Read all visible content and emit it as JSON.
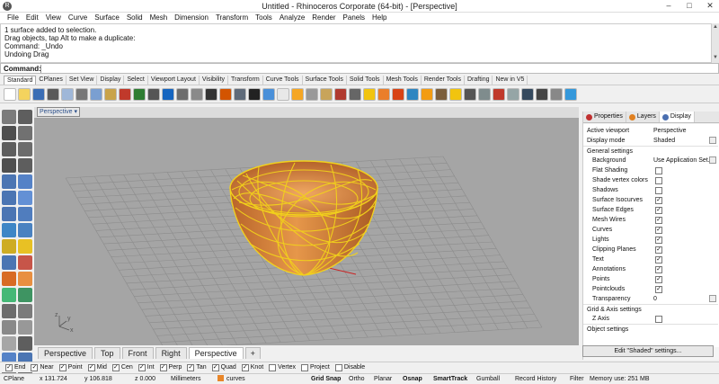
{
  "window": {
    "title": "Untitled - Rhinoceros Corporate (64-bit) - [Perspective]",
    "app_icon": "rhino-app-icon",
    "controls": {
      "minimize": "–",
      "maximize": "□",
      "close": "✕"
    }
  },
  "menu": [
    "File",
    "Edit",
    "View",
    "Curve",
    "Surface",
    "Solid",
    "Mesh",
    "Dimension",
    "Transform",
    "Tools",
    "Analyze",
    "Render",
    "Panels",
    "Help"
  ],
  "command_history": [
    "1 surface added to selection.",
    "Drag objects, tap Alt to make a duplicate:",
    "Command: _Undo",
    "Undoing Drag"
  ],
  "command_line": {
    "label": "Command:",
    "value": ""
  },
  "toolbar_tabs": [
    "Standard",
    "CPlanes",
    "Set View",
    "Display",
    "Select",
    "Viewport Layout",
    "Visibility",
    "Transform",
    "Curve Tools",
    "Surface Tools",
    "Solid Tools",
    "Mesh Tools",
    "Render Tools",
    "Drafting",
    "New in V5"
  ],
  "toolbar_active_tab": "Standard",
  "viewport": {
    "name": "Perspective",
    "background": "#a5a5a5",
    "object_color": "#d9823a",
    "wire_color": "#f2d21b",
    "axis_labels": {
      "z": "z",
      "y": "y",
      "x": "x"
    }
  },
  "viewport_tabs": [
    "Perspective",
    "Top",
    "Front",
    "Right",
    "Perspective",
    "+"
  ],
  "panel_tabs": [
    {
      "label": "Properties",
      "icon": "properties-icon",
      "color": "#c03030"
    },
    {
      "label": "Layers",
      "icon": "layers-icon",
      "color": "#e08020"
    },
    {
      "label": "Display",
      "icon": "display-icon",
      "color": "#4a6fb0"
    }
  ],
  "display_panel": {
    "active_viewport_label": "Active viewport",
    "active_viewport": "Perspective",
    "display_mode_label": "Display mode",
    "display_mode": "Shaded",
    "general_settings": "General settings",
    "background_label": "Background",
    "background_value": "Use Application Set...",
    "settings": [
      {
        "label": "Flat Shading",
        "checked": false
      },
      {
        "label": "Shade vertex colors",
        "checked": false
      },
      {
        "label": "Shadows",
        "checked": false
      },
      {
        "label": "Surface Isocurves",
        "checked": true
      },
      {
        "label": "Surface Edges",
        "checked": true
      },
      {
        "label": "Mesh Wires",
        "checked": true
      },
      {
        "label": "Curves",
        "checked": true
      },
      {
        "label": "Lights",
        "checked": true
      },
      {
        "label": "Clipping Planes",
        "checked": true
      },
      {
        "label": "Text",
        "checked": true
      },
      {
        "label": "Annotations",
        "checked": true
      },
      {
        "label": "Points",
        "checked": true
      },
      {
        "label": "Pointclouds",
        "checked": true
      }
    ],
    "transparency_label": "Transparency",
    "transparency_value": "0",
    "grid_axis": "Grid & Axis settings",
    "z_axis_label": "Z Axis",
    "object_settings": "Object settings",
    "edit_button": "Edit \"Shaded\" settings..."
  },
  "osnaps": [
    {
      "label": "End",
      "checked": true
    },
    {
      "label": "Near",
      "checked": true
    },
    {
      "label": "Point",
      "checked": true
    },
    {
      "label": "Mid",
      "checked": true
    },
    {
      "label": "Cen",
      "checked": true
    },
    {
      "label": "Int",
      "checked": true
    },
    {
      "label": "Perp",
      "checked": true
    },
    {
      "label": "Tan",
      "checked": true
    },
    {
      "label": "Quad",
      "checked": true
    },
    {
      "label": "Knot",
      "checked": true
    },
    {
      "label": "Vertex",
      "checked": false
    },
    {
      "label": "Project",
      "checked": false
    },
    {
      "label": "Disable",
      "checked": false
    }
  ],
  "status": {
    "cplane": "CPlane",
    "x": "x 131.724",
    "y": "y 106.818",
    "z": "z 0.000",
    "units": "Millimeters",
    "layer": "curves",
    "toggles": [
      "Grid Snap",
      "Ortho",
      "Planar",
      "Osnap",
      "SmartTrack",
      "Gumball",
      "Record History",
      "Filter"
    ],
    "bold_toggles": [
      "Grid Snap",
      "Osnap",
      "SmartTrack"
    ],
    "memory": "Memory use: 251 MB"
  }
}
